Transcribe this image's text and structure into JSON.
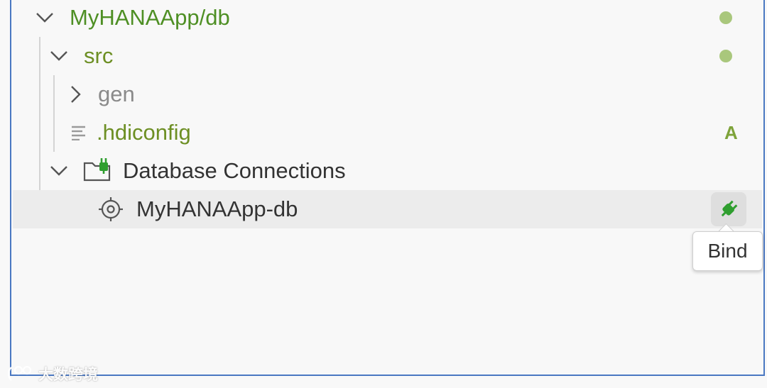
{
  "tree": {
    "root": {
      "label": "MyHANAApp/db",
      "expanded": true,
      "status_color": "#a9c77c"
    },
    "src": {
      "label": "src",
      "expanded": true,
      "status_color": "#a9c77c"
    },
    "gen": {
      "label": "gen",
      "expanded": false
    },
    "hdiconfig": {
      "label": ".hdiconfig",
      "status": "A"
    },
    "db_connections": {
      "label": "Database Connections",
      "expanded": true
    },
    "connection": {
      "label": "MyHANAApp-db",
      "action_tooltip": "Bind",
      "action_icon": "plug-icon"
    }
  },
  "colors": {
    "accent_green": "#4e8f24",
    "plug_green": "#2f9e2f",
    "selection_bg": "#ececec",
    "panel_border": "#4a78c2"
  },
  "watermark": {
    "text": "大数跨境"
  }
}
